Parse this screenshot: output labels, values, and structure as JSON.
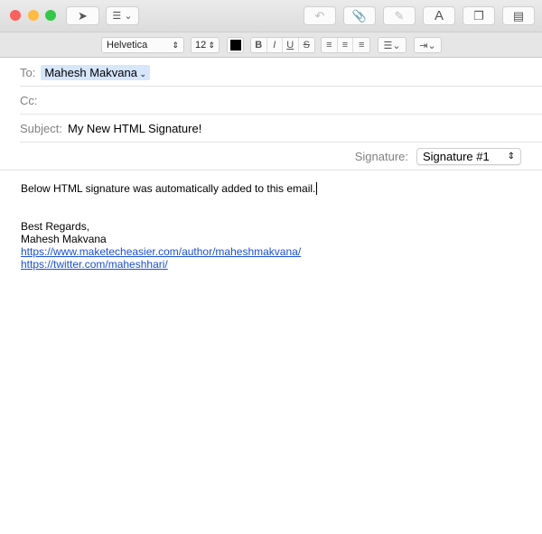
{
  "toolbar": {
    "icons": [
      "send-icon",
      "list-options-icon",
      "reply-icon",
      "paperclip-icon",
      "markup-icon",
      "font-icon",
      "window-icon",
      "photo-browser-icon"
    ],
    "font_glyph": "A"
  },
  "format": {
    "font": "Helvetica",
    "size": "12",
    "color": "#000000",
    "bold": "B",
    "italic": "I",
    "underline": "U",
    "strike": "S"
  },
  "header": {
    "to_label": "To:",
    "to_value": "Mahesh Makvana",
    "cc_label": "Cc:",
    "subject_label": "Subject:",
    "subject_value": "My New HTML Signature!",
    "signature_label": "Signature:",
    "signature_value": "Signature #1"
  },
  "body": {
    "line1": "Below HTML signature was automatically added to this email.",
    "regards": "Best Regards,",
    "name": "Mahesh Makvana",
    "link1": "https://www.maketecheasier.com/author/maheshmakvana/",
    "link2": "https://twitter.com/maheshhari/"
  }
}
